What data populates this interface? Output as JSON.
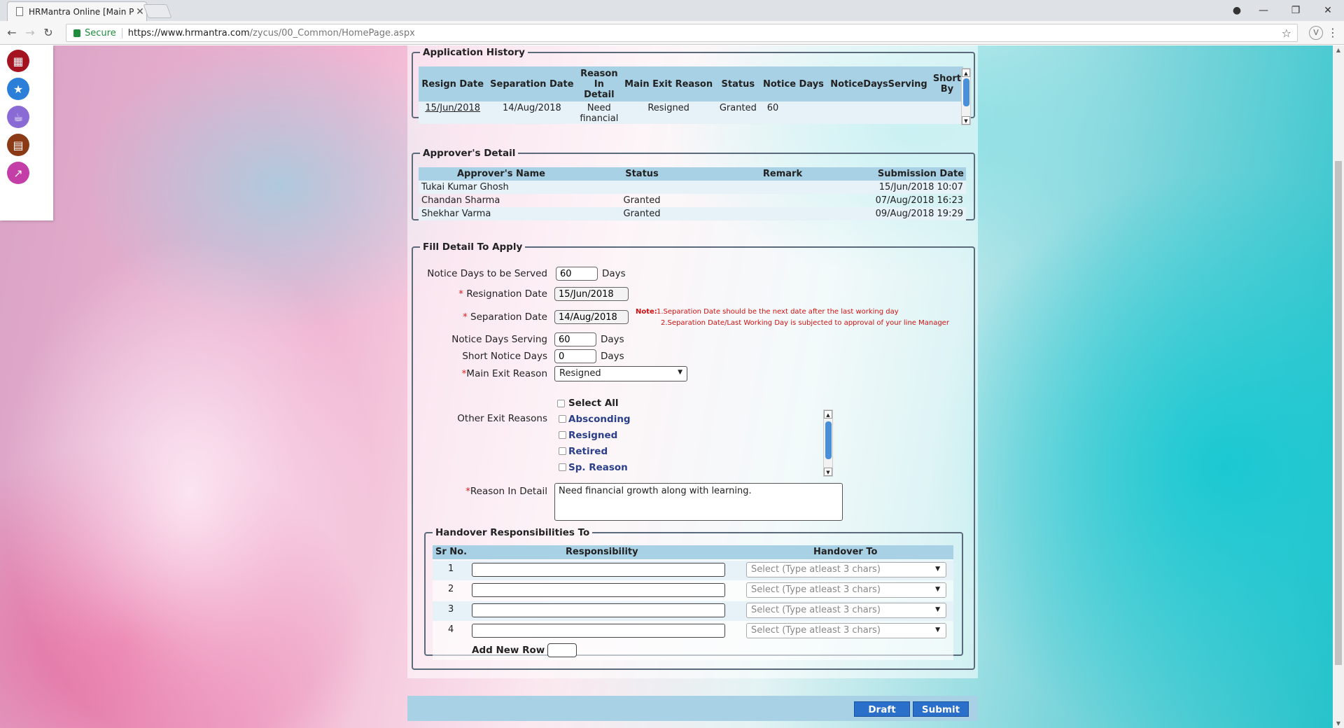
{
  "browser": {
    "tab_title": "HRMantra Online [Main P",
    "secure_label": "Secure",
    "url_host": "https://www.hrmantra.com",
    "url_path": "/zycus/00_Common/HomePage.aspx"
  },
  "sidebar": {
    "items": [
      {
        "icon": "calendar-icon",
        "color": "#a31420"
      },
      {
        "icon": "star-icon",
        "color": "#2b7fd9"
      },
      {
        "icon": "coffee-cup-icon",
        "color": "#8a6bd6"
      },
      {
        "icon": "book-icon",
        "color": "#8a3a14"
      },
      {
        "icon": "chart-icon",
        "color": "#c43ea8"
      }
    ]
  },
  "history": {
    "legend": "Application History",
    "headers": [
      "Resign Date",
      "Separation Date",
      "Reason In Detail",
      "Main Exit Reason",
      "Status",
      "Notice Days",
      "NoticeDaysServing",
      "Short By"
    ],
    "row": {
      "resign_date": "15/Jun/2018",
      "separation_date": "14/Aug/2018",
      "reason": "Need financial growth",
      "main_exit_reason": "Resigned",
      "status": "Granted",
      "notice_days": "60"
    }
  },
  "approvers": {
    "legend": "Approver's Detail",
    "headers": [
      "Approver's Name",
      "Status",
      "Remark",
      "Submission Date"
    ],
    "rows": [
      {
        "name": "Tukai Kumar Ghosh",
        "status": "",
        "remark": "",
        "date": "15/Jun/2018 10:07"
      },
      {
        "name": "Chandan Sharma",
        "status": "Granted",
        "remark": "",
        "date": "07/Aug/2018 16:23"
      },
      {
        "name": "Shekhar Varma",
        "status": "Granted",
        "remark": "",
        "date": "09/Aug/2018 19:29"
      }
    ]
  },
  "form": {
    "legend": "Fill Detail To Apply",
    "notice_days_label": "Notice Days to be Served",
    "notice_days_value": "60",
    "days_unit": "Days",
    "resignation_date_label": "Resignation Date",
    "resignation_date_value": "15/Jun/2018",
    "separation_date_label": "Separation Date",
    "separation_date_value": "14/Aug/2018",
    "note_title": "Note:",
    "note_line1": "1.Separation Date should be the next date after the last working day",
    "note_line2": "2.Separation Date/Last Working Day is subjected to approval of your line Manager",
    "notice_serving_label": "Notice Days Serving",
    "notice_serving_value": "60",
    "short_notice_label": "Short Notice Days",
    "short_notice_value": "0",
    "main_exit_label": "Main Exit Reason",
    "main_exit_value": "Resigned",
    "other_exit_label": "Other Exit Reasons",
    "select_all_label": "Select All",
    "other_reasons": [
      "Absconding",
      "Resigned",
      "Retired",
      "Sp. Reason"
    ],
    "reason_detail_label": "Reason In Detail",
    "reason_detail_value": "Need financial growth along with learning.",
    "required_mark": "*"
  },
  "handover": {
    "legend": "Handover Responsibilities To",
    "headers": [
      "Sr No.",
      "Responsibility",
      "Handover To"
    ],
    "rows": [
      "1",
      "2",
      "3",
      "4"
    ],
    "select_placeholder": "Select (Type atleast 3 chars)",
    "add_row_label": "Add New Row"
  },
  "actions": {
    "draft": "Draft",
    "submit": "Submit"
  }
}
